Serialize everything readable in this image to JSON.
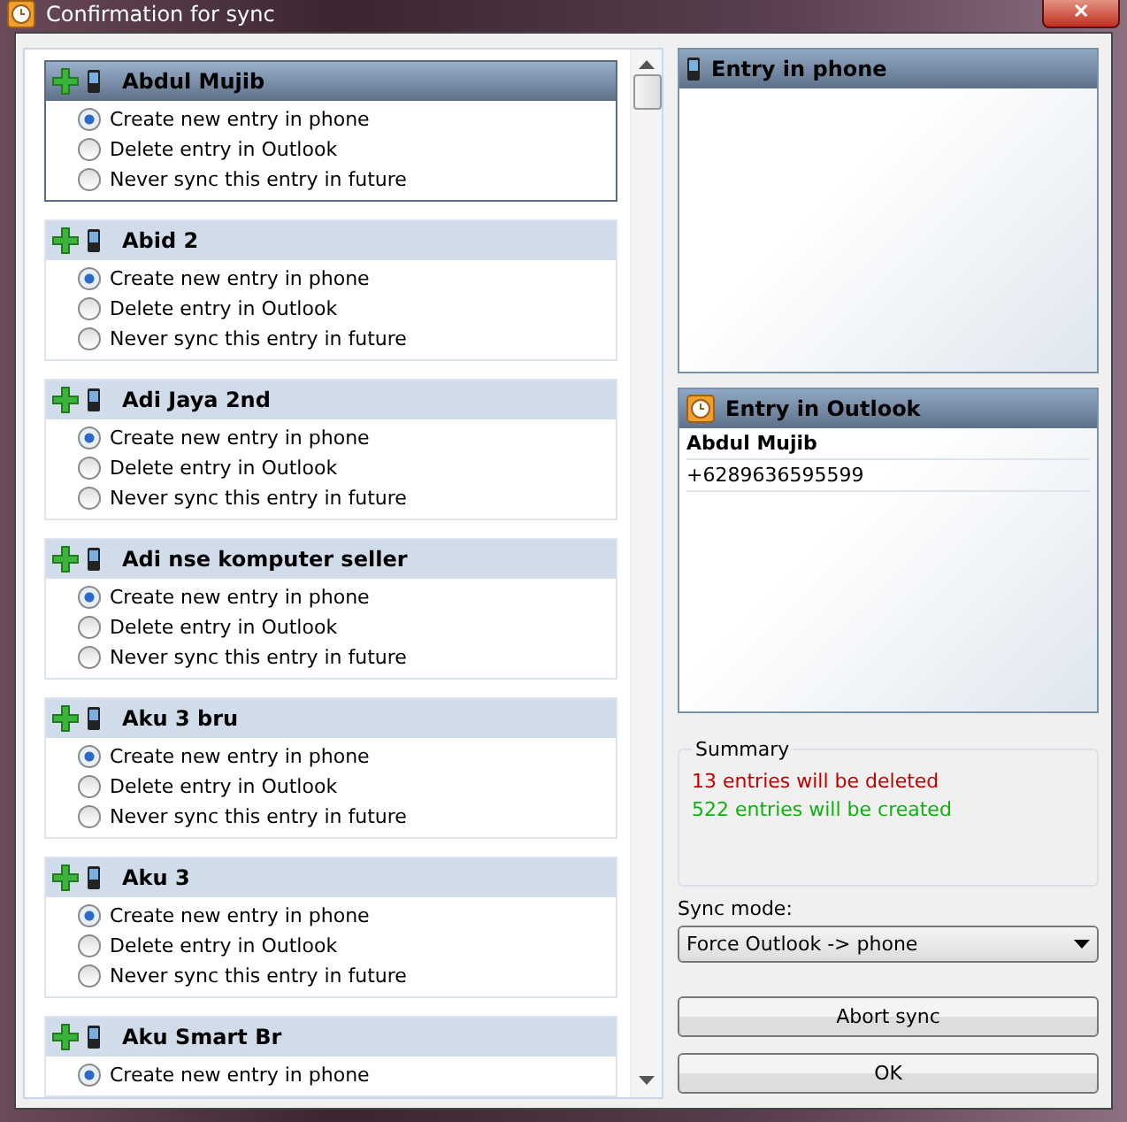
{
  "window": {
    "title": "Confirmation for sync",
    "close": "✕"
  },
  "entries": [
    {
      "name": "Abdul Mujib",
      "selected": true,
      "options": [
        {
          "label": "Create new entry in phone",
          "selected": true
        },
        {
          "label": "Delete entry in Outlook",
          "selected": false
        },
        {
          "label": "Never sync this entry in future",
          "selected": false
        }
      ]
    },
    {
      "name": "Abid 2",
      "selected": false,
      "options": [
        {
          "label": "Create new entry in phone",
          "selected": true
        },
        {
          "label": "Delete entry in Outlook",
          "selected": false
        },
        {
          "label": "Never sync this entry in future",
          "selected": false
        }
      ]
    },
    {
      "name": "Adi Jaya 2nd",
      "selected": false,
      "options": [
        {
          "label": "Create new entry in phone",
          "selected": true
        },
        {
          "label": "Delete entry in Outlook",
          "selected": false
        },
        {
          "label": "Never sync this entry in future",
          "selected": false
        }
      ]
    },
    {
      "name": "Adi nse komputer seller",
      "selected": false,
      "options": [
        {
          "label": "Create new entry in phone",
          "selected": true
        },
        {
          "label": "Delete entry in Outlook",
          "selected": false
        },
        {
          "label": "Never sync this entry in future",
          "selected": false
        }
      ]
    },
    {
      "name": "Aku 3 bru",
      "selected": false,
      "options": [
        {
          "label": "Create new entry in phone",
          "selected": true
        },
        {
          "label": "Delete entry in Outlook",
          "selected": false
        },
        {
          "label": "Never sync this entry in future",
          "selected": false
        }
      ]
    },
    {
      "name": "Aku 3",
      "selected": false,
      "options": [
        {
          "label": "Create new entry in phone",
          "selected": true
        },
        {
          "label": "Delete entry in Outlook",
          "selected": false
        },
        {
          "label": "Never sync this entry in future",
          "selected": false
        }
      ]
    },
    {
      "name": "Aku Smart Br",
      "selected": false,
      "options": [
        {
          "label": "Create new entry in phone",
          "selected": true
        }
      ]
    }
  ],
  "phone_panel": {
    "title": "Entry in phone"
  },
  "outlook_panel": {
    "title": "Entry in Outlook",
    "name": "Abdul Mujib",
    "phone": "+6289636595599"
  },
  "summary": {
    "title": "Summary",
    "deleted": "13 entries will be deleted",
    "created": "522 entries will be created"
  },
  "sync_mode": {
    "label": "Sync mode:",
    "value": "Force Outlook -> phone"
  },
  "buttons": [
    "Abort sync",
    "OK"
  ]
}
